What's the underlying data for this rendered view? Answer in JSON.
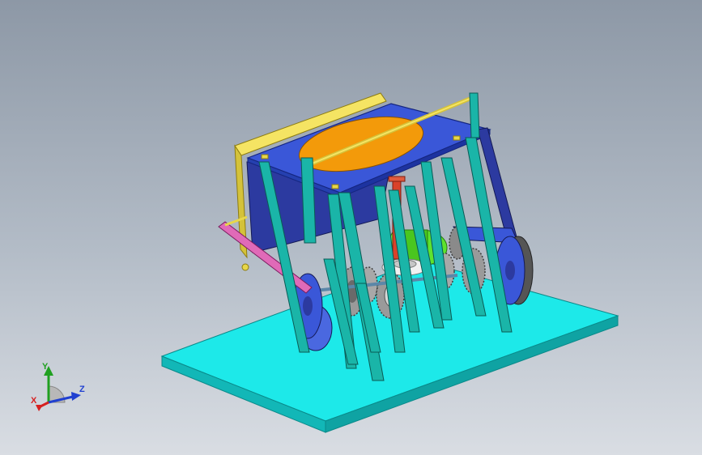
{
  "colors": {
    "background_top": "#8d98a6",
    "background_bottom": "#d9dde3",
    "base_plate": "#1de9e9",
    "frame_struts": "#1ab5a8",
    "top_plate": "#3a57d8",
    "ellipse": "#f39a0a",
    "yellow_panel": "#e7d74a",
    "dark_panel": "#2c3aa0",
    "pink_link": "#e06ab8",
    "gears": "#8a8a8a",
    "green_drum": "#5ee32e",
    "red_shaft": "#d9422a",
    "blue_wheel": "#2d4fd6"
  },
  "triad": {
    "x_label": "X",
    "y_label": "Y",
    "z_label": "Z",
    "x_color": "#d62020",
    "y_color": "#20a020",
    "z_color": "#2040d0"
  }
}
